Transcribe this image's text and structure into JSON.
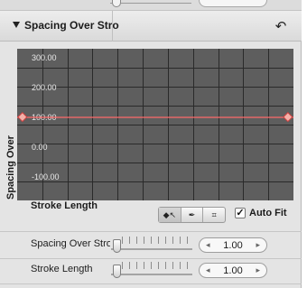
{
  "panel": {
    "section_title": "Spacing Over Stro",
    "reset_icon": "reset-arrow-icon"
  },
  "graph": {
    "y_title": "Spacing Over",
    "x_title": "Stroke Length",
    "y_ticks": [
      "300.00",
      "200.00",
      "100.00",
      "0.00",
      "-100.00"
    ],
    "curve_value": 100.0,
    "grid_background": "#5e5e5e",
    "curve_color": "#ff6a6a"
  },
  "tools": {
    "items": [
      {
        "name": "add-keyframe-tool-icon",
        "glyph": "◆↖"
      },
      {
        "name": "pen-tool-icon",
        "glyph": "✒"
      },
      {
        "name": "zoom-to-fit-icon",
        "glyph": "⌗"
      }
    ],
    "autofit_label": "Auto Fit",
    "autofit_checked": true
  },
  "params": [
    {
      "label": "Spacing Over Stro",
      "value": "1.00"
    },
    {
      "label": "Stroke Length",
      "value": "1.00"
    }
  ]
}
